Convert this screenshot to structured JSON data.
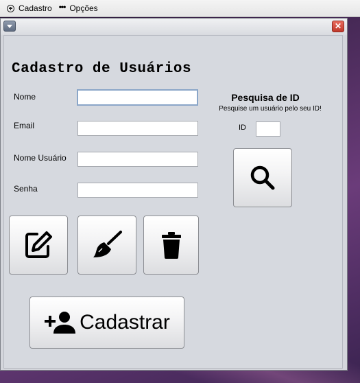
{
  "menubar": {
    "items": [
      {
        "label": "Cadastro",
        "icon": "plus-circle-icon"
      },
      {
        "label": "Opções",
        "icon": "more-dots-icon"
      }
    ]
  },
  "window": {
    "close_glyph": "✕"
  },
  "form": {
    "title": "Cadastro de Usuários",
    "fields": [
      {
        "label": "Nome",
        "value": ""
      },
      {
        "label": "Email",
        "value": ""
      },
      {
        "label": "Nome Usuário",
        "value": ""
      },
      {
        "label": "Senha",
        "value": ""
      }
    ]
  },
  "search": {
    "title": "Pesquisa de ID",
    "subtitle": "Pesquise um usuário pelo seu ID!",
    "id_label": "ID",
    "id_value": ""
  },
  "actions": {
    "edit_icon": "edit-icon",
    "clear_icon": "broom-icon",
    "delete_icon": "trash-icon",
    "search_icon": "search-icon"
  },
  "register_button": {
    "label": "Cadastrar",
    "icon": "add-user-icon"
  }
}
